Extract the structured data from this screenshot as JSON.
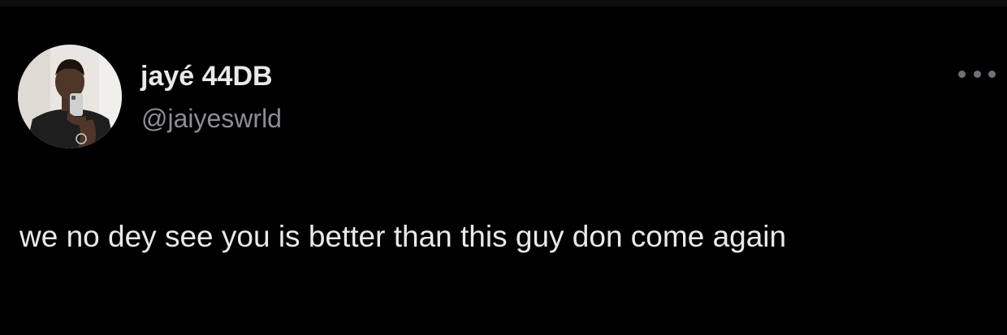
{
  "tweet": {
    "author": {
      "display_name": "jayé 44DB",
      "handle": "@jaiyeswrld",
      "avatar_icon": "profile-photo"
    },
    "more_icon": "more-horizontal-icon",
    "text": "we no dey see you is better than this guy don come again"
  },
  "colors": {
    "background": "#000000",
    "primary_text": "#e7e9ea",
    "secondary_text": "#8b8f94",
    "icon": "#6e7276"
  }
}
